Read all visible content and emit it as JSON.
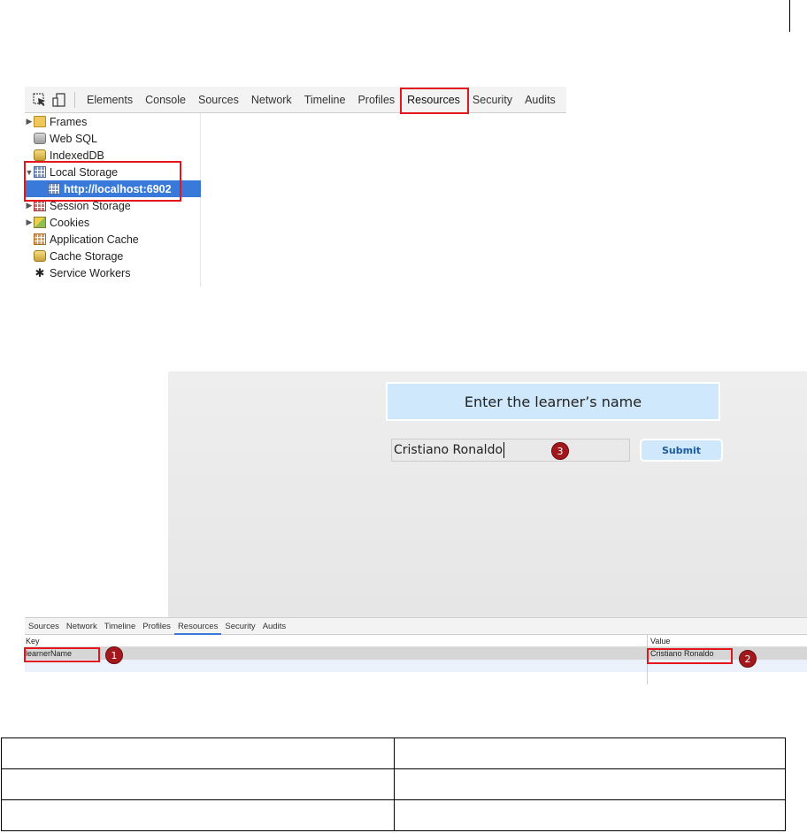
{
  "devtools_top": {
    "tabs": [
      "Elements",
      "Console",
      "Sources",
      "Network",
      "Timeline",
      "Profiles",
      "Resources",
      "Security",
      "Audits"
    ],
    "active_tab": "Resources",
    "tree": {
      "frames": "Frames",
      "web_sql": "Web SQL",
      "indexeddb": "IndexedDB",
      "local_storage": "Local Storage",
      "local_storage_origin": "http://localhost:6902",
      "session_storage": "Session Storage",
      "cookies": "Cookies",
      "application_cache": "Application Cache",
      "cache_storage": "Cache Storage",
      "service_workers": "Service Workers"
    },
    "icons": {
      "inspect": "inspect-cursor-icon",
      "device": "device-mode-icon"
    }
  },
  "app": {
    "title": "Enter the learner’s name",
    "input_value": "Cristiano Ronaldo",
    "submit_label": "Submit"
  },
  "devtools_bottom": {
    "tabs": [
      "Sources",
      "Network",
      "Timeline",
      "Profiles",
      "Resources",
      "Security",
      "Audits"
    ],
    "active_tab": "Resources",
    "columns": {
      "key": "Key",
      "value": "Value"
    },
    "rows": [
      {
        "key": "learnerName",
        "value": "Cristiano Ronaldo"
      }
    ]
  },
  "callouts": {
    "one": "1",
    "two": "2",
    "three": "3"
  },
  "colors": {
    "highlight": "#e3151d",
    "callout": "#a3181d",
    "selected": "#3879d9",
    "app_panel": "#cfe8fb"
  }
}
